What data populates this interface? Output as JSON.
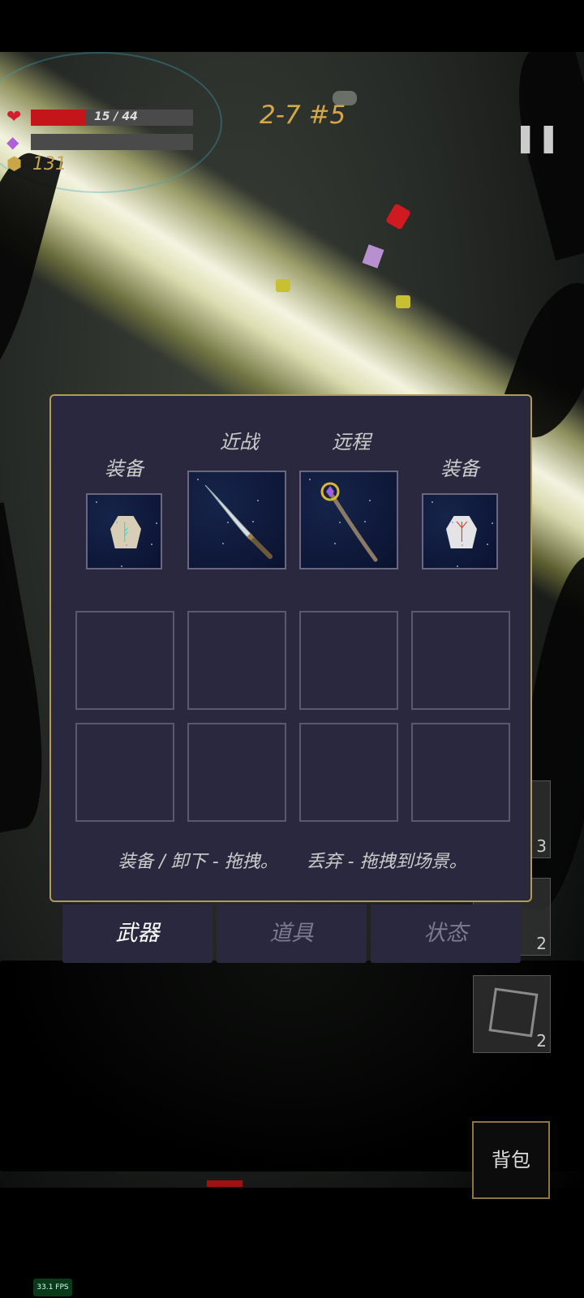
{
  "hud": {
    "health_text": "15 / 44",
    "health_current": 15,
    "health_max": 44,
    "mana_fraction": 0,
    "gold": "131",
    "level_label": "2-7 #5",
    "pause_icon": "pause-icon"
  },
  "side_slots": [
    {
      "count": "3"
    },
    {
      "count": "2"
    },
    {
      "count": "2"
    }
  ],
  "panel": {
    "melee_label": "近战",
    "ranged_label": "远程",
    "equip_left_label": "装备",
    "equip_right_label": "装备",
    "hint_equip": "装备 / 卸下 - 拖拽。",
    "hint_drop": "丢弃 - 拖拽到场景。",
    "items": {
      "left_rune": "rune-stone-cyan-icon",
      "melee": "curved-sword-icon",
      "ranged": "magic-staff-icon",
      "right_rune": "rune-stone-red-icon"
    }
  },
  "tabs": [
    {
      "label": "武器",
      "active": true
    },
    {
      "label": "道具",
      "active": false
    },
    {
      "label": "状态",
      "active": false
    }
  ],
  "bag_label": "背包",
  "fps": "33.1 FPS",
  "colors": {
    "health": "#c4151a",
    "gold": "#c9a648",
    "level": "#d4a84a",
    "panel_bg": "#2a283f",
    "panel_border": "#b89855"
  }
}
